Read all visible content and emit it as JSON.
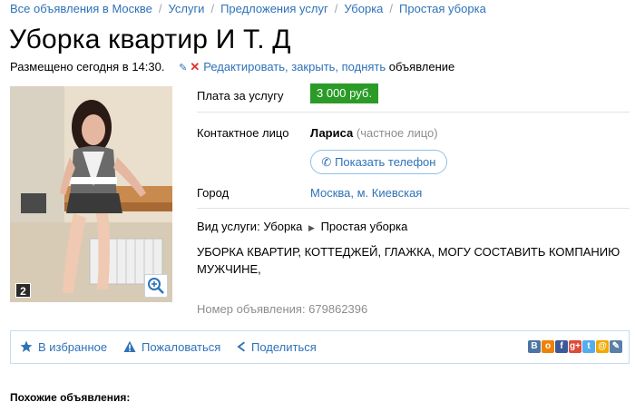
{
  "breadcrumbs": [
    "Все объявления в Москве",
    "Услуги",
    "Предложения услуг",
    "Уборка",
    "Простая уборка"
  ],
  "title": "Уборка квартир И Т. Д",
  "meta": {
    "posted": "Размещено сегодня в 14:30.",
    "edit_link": "Редактировать, закрыть, поднять",
    "edit_suffix": " объявление"
  },
  "photo": {
    "count": "2"
  },
  "fields": {
    "price_label": "Плата за услугу",
    "price": "3 000 руб.",
    "contact_label": "Контактное лицо",
    "contact_name": "Лариса",
    "contact_type": "(частное лицо)",
    "show_phone": "Показать телефон",
    "city_label": "Город",
    "city": "Москва, м. Киевская"
  },
  "service": {
    "label": "Вид услуги:",
    "category": "Уборка",
    "subcategory": "Простая уборка"
  },
  "description": "УБОРКА КВАРТИР, КОТТЕДЖЕЙ, ГЛАЖКА, МОГУ СОСТАВИТЬ КОМПАНИЮ МУЖЧИНЕ,",
  "ad_number": "Номер объявления: 679862396",
  "actions": {
    "favorite": "В избранное",
    "report": "Пожаловаться",
    "share": "Поделиться"
  },
  "social": [
    {
      "icon": "vk-icon",
      "glyph": "В",
      "color": "#4c75a3"
    },
    {
      "icon": "odnoklassniki-icon",
      "glyph": "о",
      "color": "#ee8208"
    },
    {
      "icon": "facebook-icon",
      "glyph": "f",
      "color": "#3b5998"
    },
    {
      "icon": "google-plus-icon",
      "glyph": "g+",
      "color": "#dd4b39"
    },
    {
      "icon": "twitter-icon",
      "glyph": "t",
      "color": "#55acee"
    },
    {
      "icon": "mail-ru-icon",
      "glyph": "@",
      "color": "#f2a900"
    },
    {
      "icon": "livejournal-icon",
      "glyph": "✎",
      "color": "#5a7fa8"
    }
  ],
  "similar_heading": "Похожие объявления:",
  "colors": {
    "link": "#2e72b8",
    "price_bg": "#2a9b27",
    "border": "#c7dced"
  }
}
